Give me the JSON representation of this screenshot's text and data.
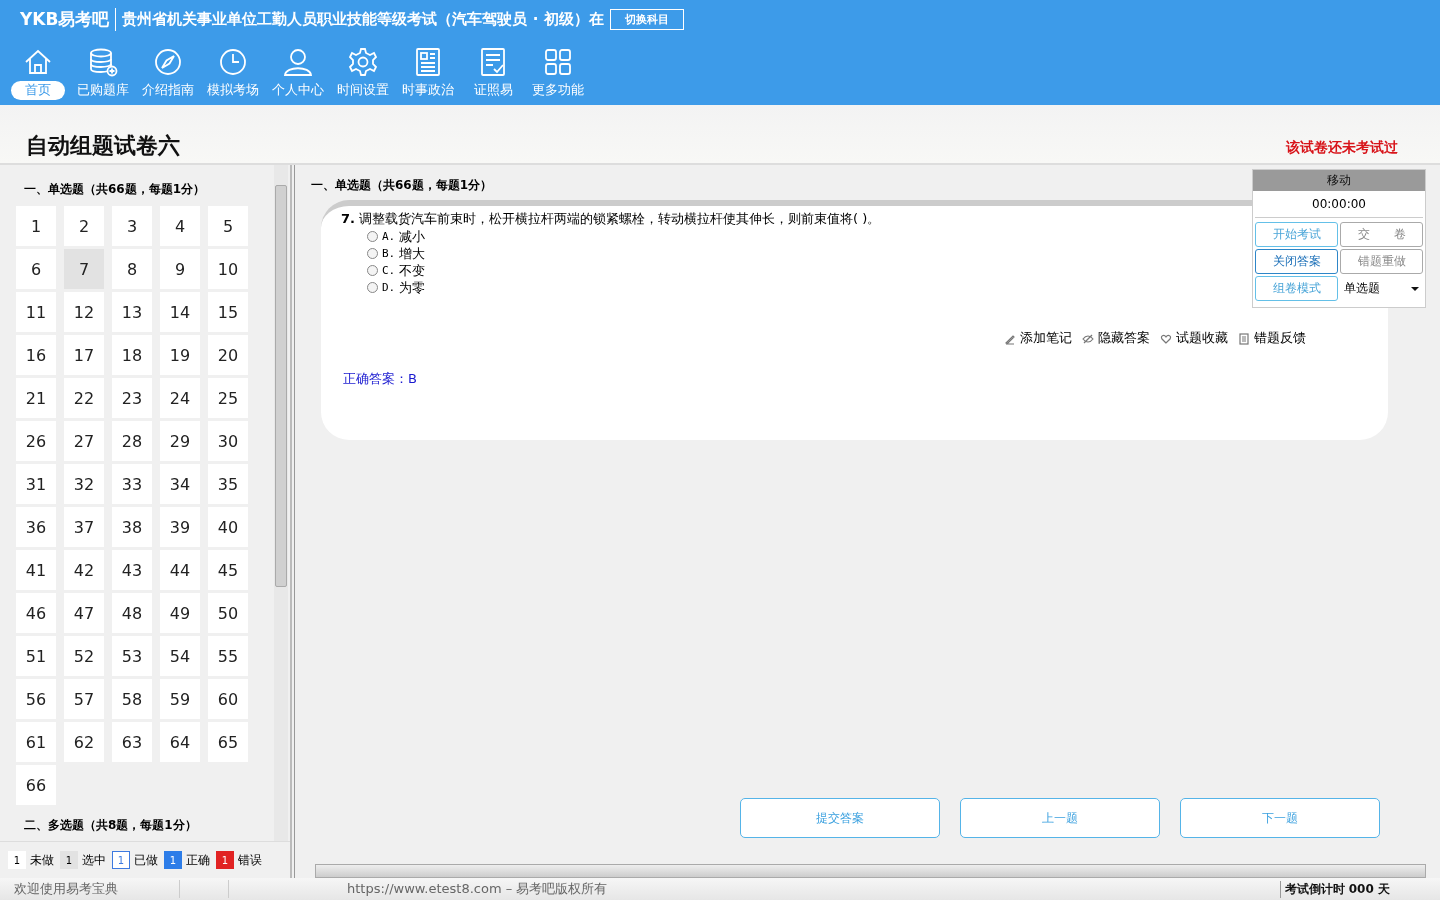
{
  "header": {
    "logo": "YKB易考吧",
    "title": "贵州省机关事业单位工勤人员职业技能等级考试（汽车驾驶员 · 初级）在",
    "switch_button": "切换科目"
  },
  "nav": [
    {
      "label": "首页",
      "selected": true
    },
    {
      "label": "已购题库",
      "selected": false
    },
    {
      "label": "介绍指南",
      "selected": false
    },
    {
      "label": "模拟考场",
      "selected": false
    },
    {
      "label": "个人中心",
      "selected": false
    },
    {
      "label": "时间设置",
      "selected": false
    },
    {
      "label": "时事政治",
      "selected": false
    },
    {
      "label": "证照易",
      "selected": false
    },
    {
      "label": "更多功能",
      "selected": false
    }
  ],
  "page_title": "自动组题试卷六",
  "exam_status": "该试卷还未考试过",
  "sidebar": {
    "section_title": "一、单选题（共66题，每题1分）",
    "next_section": "二、多选题（共8题，每题1分）",
    "numbers": [
      {
        "label": "1",
        "selected": false
      },
      {
        "label": "2",
        "selected": false
      },
      {
        "label": "3",
        "selected": false
      },
      {
        "label": "4",
        "selected": false
      },
      {
        "label": "5",
        "selected": false
      },
      {
        "label": "6",
        "selected": false
      },
      {
        "label": "7",
        "selected": true
      },
      {
        "label": "8",
        "selected": false
      },
      {
        "label": "9",
        "selected": false
      },
      {
        "label": "10",
        "selected": false
      },
      {
        "label": "11",
        "selected": false
      },
      {
        "label": "12",
        "selected": false
      },
      {
        "label": "13",
        "selected": false
      },
      {
        "label": "14",
        "selected": false
      },
      {
        "label": "15",
        "selected": false
      },
      {
        "label": "16",
        "selected": false
      },
      {
        "label": "17",
        "selected": false
      },
      {
        "label": "18",
        "selected": false
      },
      {
        "label": "19",
        "selected": false
      },
      {
        "label": "20",
        "selected": false
      },
      {
        "label": "21",
        "selected": false
      },
      {
        "label": "22",
        "selected": false
      },
      {
        "label": "23",
        "selected": false
      },
      {
        "label": "24",
        "selected": false
      },
      {
        "label": "25",
        "selected": false
      },
      {
        "label": "26",
        "selected": false
      },
      {
        "label": "27",
        "selected": false
      },
      {
        "label": "28",
        "selected": false
      },
      {
        "label": "29",
        "selected": false
      },
      {
        "label": "30",
        "selected": false
      },
      {
        "label": "31",
        "selected": false
      },
      {
        "label": "32",
        "selected": false
      },
      {
        "label": "33",
        "selected": false
      },
      {
        "label": "34",
        "selected": false
      },
      {
        "label": "35",
        "selected": false
      },
      {
        "label": "36",
        "selected": false
      },
      {
        "label": "37",
        "selected": false
      },
      {
        "label": "38",
        "selected": false
      },
      {
        "label": "39",
        "selected": false
      },
      {
        "label": "40",
        "selected": false
      },
      {
        "label": "41",
        "selected": false
      },
      {
        "label": "42",
        "selected": false
      },
      {
        "label": "43",
        "selected": false
      },
      {
        "label": "44",
        "selected": false
      },
      {
        "label": "45",
        "selected": false
      },
      {
        "label": "46",
        "selected": false
      },
      {
        "label": "47",
        "selected": false
      },
      {
        "label": "48",
        "selected": false
      },
      {
        "label": "49",
        "selected": false
      },
      {
        "label": "50",
        "selected": false
      },
      {
        "label": "51",
        "selected": false
      },
      {
        "label": "52",
        "selected": false
      },
      {
        "label": "53",
        "selected": false
      },
      {
        "label": "54",
        "selected": false
      },
      {
        "label": "55",
        "selected": false
      },
      {
        "label": "56",
        "selected": false
      },
      {
        "label": "57",
        "selected": false
      },
      {
        "label": "58",
        "selected": false
      },
      {
        "label": "59",
        "selected": false
      },
      {
        "label": "60",
        "selected": false
      },
      {
        "label": "61",
        "selected": false
      },
      {
        "label": "62",
        "selected": false
      },
      {
        "label": "63",
        "selected": false
      },
      {
        "label": "64",
        "selected": false
      },
      {
        "label": "65",
        "selected": false
      },
      {
        "label": "66",
        "selected": false
      }
    ]
  },
  "legend": [
    {
      "sample": "1",
      "label": "未做",
      "kind": "todo"
    },
    {
      "sample": "1",
      "label": "选中",
      "kind": "current"
    },
    {
      "sample": "1",
      "label": "已做",
      "kind": "done"
    },
    {
      "sample": "1",
      "label": "正确",
      "kind": "right"
    },
    {
      "sample": "1",
      "label": "错误",
      "kind": "wrong"
    }
  ],
  "question": {
    "section_title": "一、单选题（共66题，每题1分）",
    "number": "7.",
    "text": "调整载货汽车前束时，松开横拉杆两端的锁紧螺栓，转动横拉杆使其伸长，则前束值将(  )。",
    "options": [
      {
        "label": "A.",
        "text": "减小",
        "selected": false
      },
      {
        "label": "B.",
        "text": "增大",
        "selected": false
      },
      {
        "label": "C.",
        "text": "不变",
        "selected": false
      },
      {
        "label": "D.",
        "text": "为零",
        "selected": false
      }
    ],
    "tools": [
      {
        "label": "添加笔记",
        "kind": "note"
      },
      {
        "label": "隐藏答案",
        "kind": "hide"
      },
      {
        "label": "试题收藏",
        "kind": "favorite"
      },
      {
        "label": "错题反馈",
        "kind": "feedback"
      }
    ],
    "answer": "正确答案：B"
  },
  "control_panel": {
    "title": "移动",
    "timer": "00:00:00",
    "buttons": [
      {
        "label": "开始考试",
        "kind": "primary"
      },
      {
        "label": "交　　卷",
        "kind": "muted"
      },
      {
        "label": "关闭答案",
        "kind": "active"
      },
      {
        "label": "错题重做",
        "kind": "muted"
      },
      {
        "label": "组卷模式",
        "kind": "primary"
      }
    ],
    "type_select": "单选题"
  },
  "actions": [
    "提交答案",
    "上一题",
    "下一题"
  ],
  "status_bar": {
    "welcome": "欢迎使用易考宝典",
    "copyright": "https://www.etest8.com – 易考吧版权所有",
    "countdown": "考试倒计时 000 天"
  }
}
